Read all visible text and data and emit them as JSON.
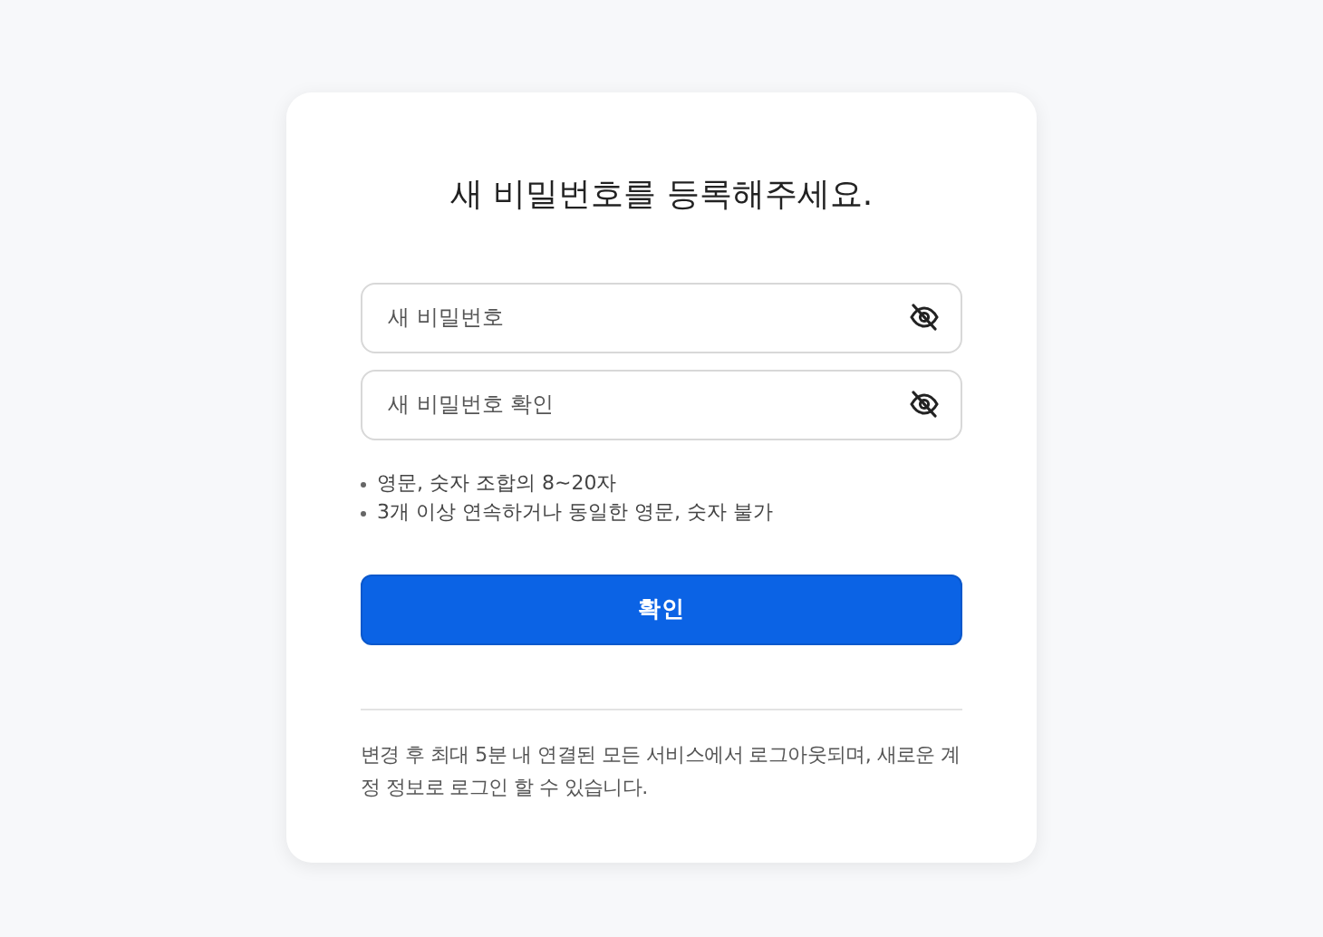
{
  "title": "새 비밀번호를 등록해주세요.",
  "fields": [
    {
      "placeholder": "새 비밀번호",
      "revealed": false
    },
    {
      "placeholder": "새 비밀번호 확인",
      "revealed": false
    }
  ],
  "rules": [
    "영문, 숫자 조합의 8~20자",
    "3개 이상 연속하거나 동일한 영문, 숫자 불가"
  ],
  "submit_button": "확인",
  "note": "변경 후 최대 5분 내 연결된 모든 서비스에서 로그아웃되며, 새로운 계정 정보로 로그인 할 수 있습니다."
}
